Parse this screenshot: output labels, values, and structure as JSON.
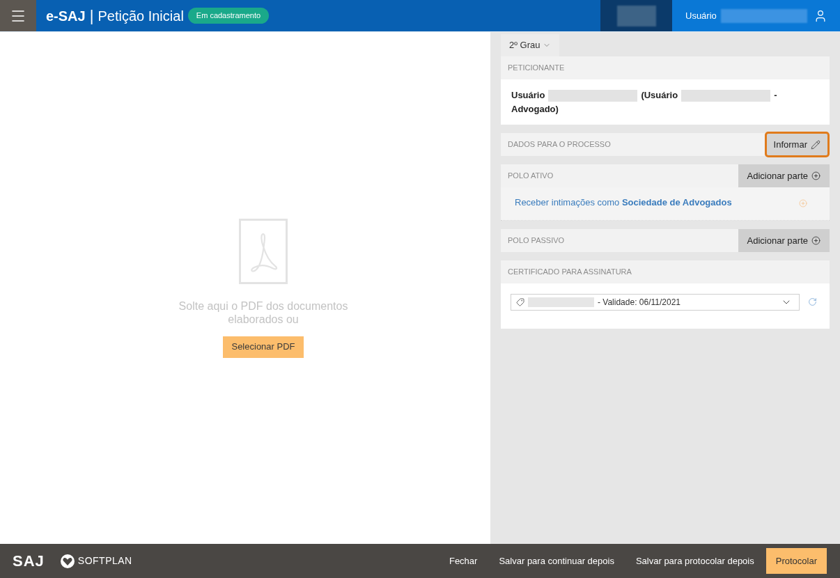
{
  "header": {
    "app_name": "e-SAJ",
    "separator": "|",
    "page_title": "Petição Inicial",
    "status_badge": "Em cadastramento",
    "user_label": "Usuário"
  },
  "dropzone": {
    "message": "Solte aqui o PDF dos documentos elaborados ou",
    "button": "Selecionar PDF"
  },
  "panel": {
    "instance_dropdown": {
      "label": "2º Grau"
    },
    "sections": [
      {
        "kind": "peticionante",
        "title": "PETICIONANTE",
        "segments": [
          {
            "kind": "text",
            "text": "Usuário"
          },
          {
            "kind": "redacted"
          },
          {
            "kind": "text",
            "text": "(Usuário"
          },
          {
            "kind": "redacted"
          },
          {
            "kind": "text",
            "text": "-"
          },
          {
            "kind": "text",
            "text": "Advogado)"
          }
        ]
      },
      {
        "kind": "action",
        "title": "DADOS PARA O PROCESSO",
        "button": {
          "label": "Informar",
          "highlighted": true
        }
      },
      {
        "kind": "party",
        "title": "POLO ATIVO",
        "button": {
          "label": "Adicionar parte",
          "highlighted": false
        },
        "link": "Receber intimações como **Sociedade de Advogados**"
      },
      {
        "kind": "party",
        "title": "POLO PASSIVO",
        "button": {
          "label": "Adicionar parte",
          "highlighted": false
        }
      },
      {
        "kind": "certificate",
        "title": "CERTIFICADO PARA ASSINATURA",
        "select_value": "- Validade: 06/11/2021"
      }
    ]
  },
  "footer": {
    "brand": "SAJ",
    "company": "SOFTPLAN",
    "actions": [
      {
        "label": "Fechar",
        "kind": "link"
      },
      {
        "label": "Salvar para continuar depois",
        "kind": "link"
      },
      {
        "label": "Salvar para protocolar depois",
        "kind": "link"
      },
      {
        "label": "Protocolar",
        "kind": "primary"
      }
    ]
  }
}
